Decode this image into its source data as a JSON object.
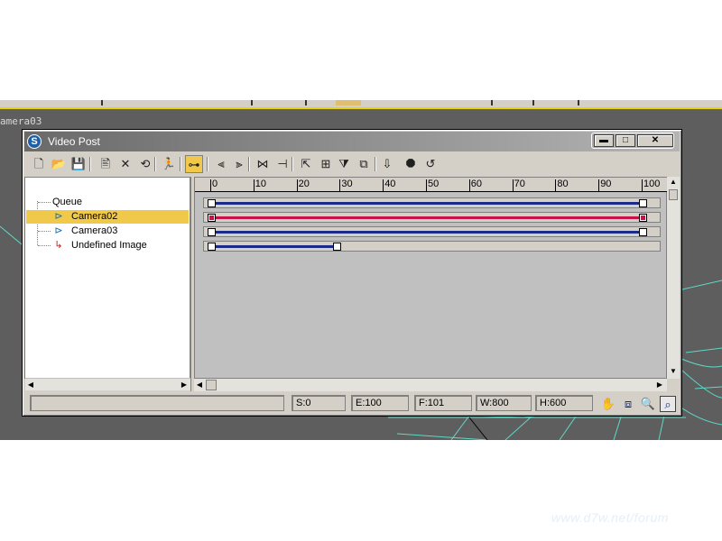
{
  "viewport": {
    "label": "amera03",
    "bg": "#5e5e5e",
    "wire_color": "#5fd8c8"
  },
  "watermark": "www.d7w.net/forum",
  "window": {
    "title": "Video Post",
    "icon": "3ds-max-logo-icon",
    "buttons": {
      "minimize": "▬",
      "maximize": "□",
      "close": "✕"
    }
  },
  "toolbar": {
    "items": [
      {
        "name": "new-sequence-icon",
        "glyph": "🗋"
      },
      {
        "name": "open-sequence-icon",
        "glyph": "📂"
      },
      {
        "name": "save-sequence-icon",
        "glyph": "💾"
      },
      {
        "name": "edit-current-event-icon",
        "glyph": "🖹"
      },
      {
        "name": "delete-current-event-icon",
        "glyph": "✕"
      },
      {
        "name": "swap-events-icon",
        "glyph": "⟲"
      },
      {
        "name": "execute-sequence-icon",
        "glyph": "🏃"
      },
      {
        "name": "edit-range-bar-icon",
        "glyph": "⊶"
      },
      {
        "name": "align-left-icon",
        "glyph": "⫷"
      },
      {
        "name": "align-right-icon",
        "glyph": "⫸"
      },
      {
        "name": "make-same-size-icon",
        "glyph": "⋈"
      },
      {
        "name": "abut-selected-icon",
        "glyph": "⊣"
      },
      {
        "name": "add-scene-event-icon",
        "glyph": "⇱"
      },
      {
        "name": "add-image-input-event-icon",
        "glyph": "⊞"
      },
      {
        "name": "add-image-filter-event-icon",
        "glyph": "⧩"
      },
      {
        "name": "add-image-layer-event-icon",
        "glyph": "⧉"
      },
      {
        "name": "add-image-output-event-icon",
        "glyph": "⇩"
      },
      {
        "name": "add-external-event-icon",
        "glyph": "⯃"
      },
      {
        "name": "add-loop-event-icon",
        "glyph": "↺"
      }
    ]
  },
  "queue": {
    "root": "Queue",
    "items": [
      {
        "label": "Camera02",
        "icon": "scene-event-icon",
        "selected": true
      },
      {
        "label": "Camera03",
        "icon": "scene-event-icon",
        "selected": false
      },
      {
        "label": "Undefined Image",
        "icon": "image-output-event-icon",
        "selected": false
      }
    ]
  },
  "ruler": {
    "labels": [
      "0",
      "10",
      "20",
      "30",
      "40",
      "50",
      "60",
      "70",
      "80",
      "90",
      "100"
    ],
    "min": 0,
    "max": 100
  },
  "tracks": [
    {
      "start": 0,
      "end": 100,
      "color": "#1a2a8a",
      "selected": false
    },
    {
      "start": 0,
      "end": 100,
      "color": "#c8104a",
      "selected": true
    },
    {
      "start": 0,
      "end": 100,
      "color": "#1a2a8a",
      "selected": false
    },
    {
      "start": 0,
      "end": 29,
      "color": "#1a2a8a",
      "selected": false
    }
  ],
  "status": {
    "message": "",
    "start": "S:0",
    "end": "E:100",
    "frames": "F:101",
    "width": "W:800",
    "height": "H:600"
  },
  "nav_icons": [
    "pan-icon",
    "zoom-extents-icon",
    "zoom-time-icon",
    "zoom-region-icon"
  ],
  "colors": {
    "selected_bg": "#f0c84a",
    "selected_track": "#c8104a",
    "track": "#1a2a8a"
  }
}
